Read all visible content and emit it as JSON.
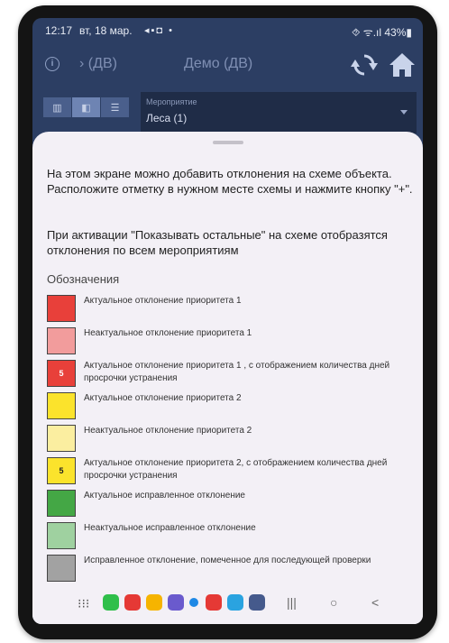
{
  "status_bar": {
    "time": "12:17",
    "date": "вт, 18 мар.",
    "right": "⯑ ᯤ.ıl 43%▮"
  },
  "app_bar": {
    "back_label": "› (ДВ)",
    "title": "Демо (ДВ)"
  },
  "toolbar": {
    "event_label": "Мероприятие",
    "event_value": "Леса (1)"
  },
  "sheet": {
    "paragraph1": "На этом экране можно добавить отклонения на схеме объекта. Расположите отметку в нужном месте схемы и нажмите кнопку \"+\".",
    "paragraph2": "При активации \"Показывать остальные\" на схеме отобразятся отклонения по всем мероприятиям",
    "legend_title": "Обозначения",
    "legend": [
      {
        "color": "#e8403a",
        "number": "",
        "text": "Актуальное отклонение приоритета 1"
      },
      {
        "color": "#f29c9c",
        "number": "",
        "text": "Неактуальное отклонение приоритета 1"
      },
      {
        "color": "#e8403a",
        "number": "5",
        "text": "Актуальное отклонение приоритета 1 , с отображением количества дней просрочки устранения"
      },
      {
        "color": "#fbe32c",
        "number": "",
        "text": "Актуальное отклонение приоритета 2"
      },
      {
        "color": "#fbeea0",
        "number": "",
        "text": "Неактуальное отклонение приоритета 2"
      },
      {
        "color": "#fbe32c",
        "number": "5",
        "text": "Актуальное отклонение приоритета 2, с отображением количества дней просрочки устранения"
      },
      {
        "color": "#44a745",
        "number": "",
        "text": "Актуальное исправленное отклонение"
      },
      {
        "color": "#9fd1a0",
        "number": "",
        "text": "Неактуальное исправленное отклонение"
      },
      {
        "color": "#a2a2a2",
        "number": "",
        "text": "Исправленное отклонение, помеченное для последующей проверки"
      }
    ]
  },
  "nav_bar": {
    "apps": [
      {
        "name": "whatsapp",
        "color": "#2fbf4a"
      },
      {
        "name": "app-red",
        "color": "#e53935"
      },
      {
        "name": "app-yellow",
        "color": "#f6b400"
      },
      {
        "name": "messages",
        "color": "#6a5acd"
      },
      {
        "name": "app-blue",
        "color": "#1e88e5"
      },
      {
        "name": "youtube",
        "color": "#e53935"
      },
      {
        "name": "telegram",
        "color": "#2aa3e0"
      },
      {
        "name": "settings",
        "color": "#455a8c"
      }
    ],
    "recents_glyph": "|||",
    "home_glyph": "○",
    "back_glyph": "<"
  }
}
